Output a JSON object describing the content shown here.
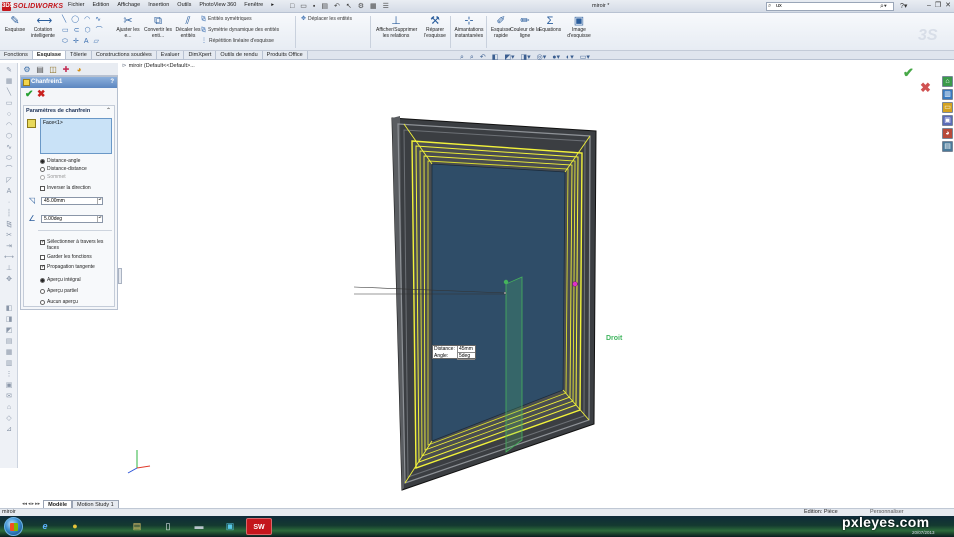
{
  "app": {
    "logo_text": "SOLIDWORKS",
    "logo_mark": "3DS",
    "doc_title": "miroir *",
    "search_value": "ux",
    "menu": [
      "Fichier",
      "Edition",
      "Affichage",
      "Insertion",
      "Outils",
      "PhotoView 360",
      "Fenêtre"
    ],
    "menu_more": "▸"
  },
  "ribbon": {
    "big_buttons": [
      {
        "label": "Esquisse",
        "icon": "sketch-icon"
      },
      {
        "label": "Cotation intelligente",
        "icon": "smart-dimension-icon"
      },
      {
        "label": "Ajuster les e...",
        "icon": "trim-icon"
      },
      {
        "label": "Convertir les enti...",
        "icon": "convert-entities-icon"
      },
      {
        "label": "Décaler les entités",
        "icon": "offset-entities-icon"
      },
      {
        "label": "Afficher/Supprimer les relations",
        "icon": "relations-icon"
      },
      {
        "label": "Réparer l'esquisse",
        "icon": "repair-sketch-icon"
      },
      {
        "label": "Aimantations instantanées",
        "icon": "snap-icon"
      },
      {
        "label": "Esquisse rapide",
        "icon": "rapid-sketch-icon"
      },
      {
        "label": "Couleur de la ligne",
        "icon": "line-color-icon"
      },
      {
        "label": "Equations",
        "icon": "equations-icon"
      },
      {
        "label": "Image d'esquisse",
        "icon": "sketch-picture-icon"
      }
    ],
    "items": [
      {
        "label": "Entités symétriques"
      },
      {
        "label": "Symétrie dynamique des entités"
      },
      {
        "label": "Répétition linéaire d'esquisse"
      },
      {
        "label": "Déplacer les entités"
      }
    ]
  },
  "tabs": [
    "Fonctions",
    "Esquisse",
    "Tôlerie",
    "Constructions soudées",
    "Evaluer",
    "DimXpert",
    "Outils de rendu",
    "Produits Office"
  ],
  "active_tab": "Esquisse",
  "feature_path": "miroir  (Default<<Default>...",
  "property_manager": {
    "title": "Chanfrein1",
    "help": "?",
    "ok_symbol": "✔",
    "cancel_symbol": "✖",
    "section_title": "Paramètres de chanfrein",
    "collapse_symbol": "⌃",
    "selection_list": [
      "Face<1>"
    ],
    "chamfer_types": [
      {
        "label": "Distance-angle",
        "selected": true,
        "disabled": false
      },
      {
        "label": "Distance-distance",
        "selected": false,
        "disabled": false
      },
      {
        "label": "Sommet",
        "selected": false,
        "disabled": true
      }
    ],
    "flip_direction": {
      "label": "Inverser la direction",
      "checked": false
    },
    "distance_value": "45.00mm",
    "angle_value": "5.00deg",
    "options": [
      {
        "label": "Sélectionner à travers les faces",
        "checked": true
      },
      {
        "label": "Garder les fonctions",
        "checked": false
      },
      {
        "label": "Propagation tangente",
        "checked": true
      }
    ],
    "preview": [
      {
        "label": "Aperçu intégral",
        "selected": true
      },
      {
        "label": "Aperçu partiel",
        "selected": false
      },
      {
        "label": "Aucun aperçu",
        "selected": false
      }
    ]
  },
  "graphics": {
    "dimension_callout": [
      {
        "label": "Distance:",
        "value": "45mm"
      },
      {
        "label": "Angle:",
        "value": "5deg"
      }
    ],
    "plane_label": "Droit"
  },
  "bottom_tabs": [
    "Modèle",
    "Motion Study 1"
  ],
  "bottom_scroll": [
    "◂◂",
    "◂",
    "▸",
    "▸▸"
  ],
  "active_bottom_tab": "Modèle",
  "status": {
    "left": "miroir",
    "edit_mode": "Edition: Pièce",
    "unit": "Personnaliser"
  },
  "taskbar": {
    "date": "20/07/2013",
    "watermark": "pxleyes.com",
    "apps": [
      {
        "name": "internet-explorer",
        "symbol": "e"
      },
      {
        "name": "chrome",
        "symbol": "●"
      },
      {
        "name": "file-explorer",
        "symbol": "▤"
      },
      {
        "name": "notepad",
        "symbol": "▯"
      },
      {
        "name": "media",
        "symbol": "▬"
      },
      {
        "name": "photos",
        "symbol": "▣"
      },
      {
        "name": "solidworks",
        "symbol": "SW"
      }
    ]
  },
  "colors": {
    "accent": "#5c86c0",
    "selection_yellow": "#f2f23a",
    "frame_dark": "#3a3d40",
    "glass": "#2f4d68",
    "ok_green": "#27a033",
    "cancel_red": "#c9211e"
  }
}
